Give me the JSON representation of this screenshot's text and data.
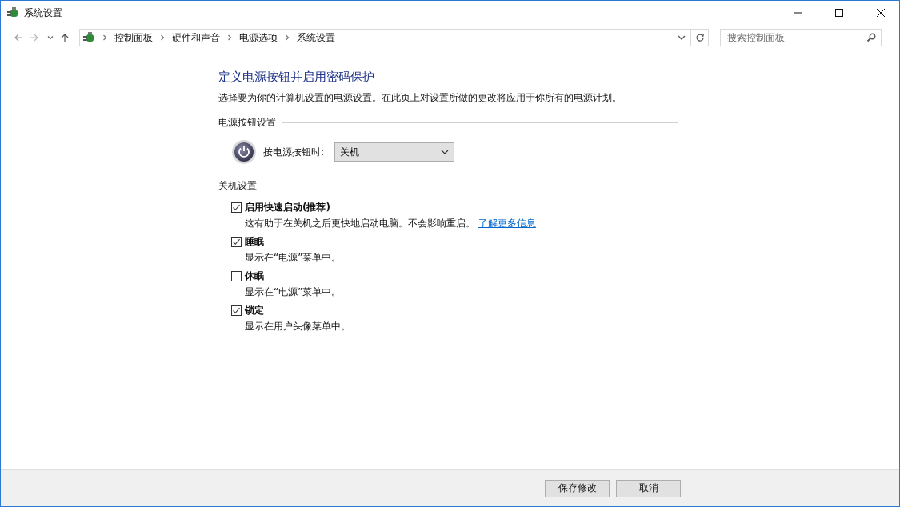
{
  "window": {
    "title": "系统设置"
  },
  "address_bar": {
    "breadcrumbs": [
      "控制面板",
      "硬件和声音",
      "电源选项",
      "系统设置"
    ]
  },
  "search": {
    "placeholder": "搜索控制面板"
  },
  "page": {
    "heading": "定义电源按钮并启用密码保护",
    "description": "选择要为你的计算机设置的电源设置。在此页上对设置所做的更改将应用于你所有的电源计划。"
  },
  "power_button_section": {
    "title": "电源按钮设置",
    "label": "按电源按钮时:",
    "value": "关机"
  },
  "shutdown_section": {
    "title": "关机设置",
    "options": [
      {
        "label": "启用快速启动(推荐)",
        "checked": true,
        "description": "这有助于在关机之后更快地启动电脑。不会影响重启。",
        "link": "了解更多信息"
      },
      {
        "label": "睡眠",
        "checked": true,
        "description": "显示在“电源”菜单中。"
      },
      {
        "label": "休眠",
        "checked": false,
        "description": "显示在“电源”菜单中。"
      },
      {
        "label": "锁定",
        "checked": true,
        "description": "显示在用户头像菜单中。"
      }
    ]
  },
  "buttons": [
    "保存修改",
    "取消"
  ]
}
